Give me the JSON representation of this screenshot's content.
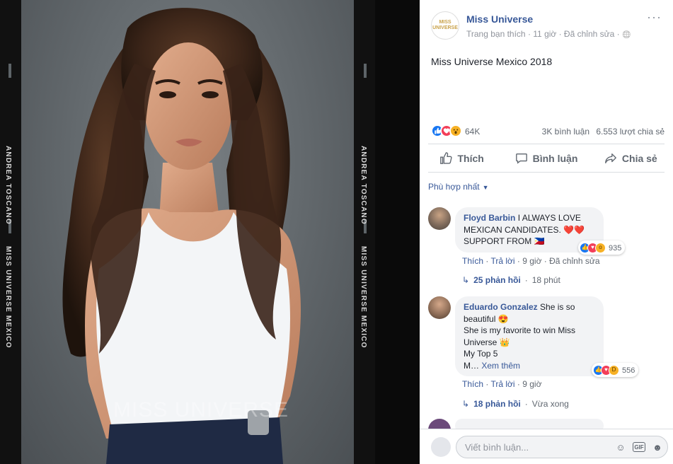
{
  "photo": {
    "side_label_name": "ANDREA TOSCANO",
    "side_label_title": "MISS UNIVERSE MEXICO",
    "watermark": "MISS UNIVERSE"
  },
  "post": {
    "page_avatar_top": "MISS",
    "page_avatar_bottom": "UNIVERSE",
    "page_name": "Miss Universe",
    "meta": "Trang bạn thích · 11 giờ · Đã chỉnh sửa ·",
    "globe_icon": "🌐",
    "more_icon": "···",
    "caption": "Miss Universe Mexico 2018",
    "reaction_count": "64K",
    "comment_count": "3K bình luận",
    "share_count": "6.553 lượt chia sẻ",
    "actions": {
      "like": "Thích",
      "comment": "Bình luận",
      "share": "Chia sẻ"
    },
    "sort_label": "Phù hợp nhất"
  },
  "comments": [
    {
      "author": "Floyd Barbin",
      "text": "I ALWAYS LOVE MEXICAN CANDIDATES. ❤️❤️ SUPPORT FROM 🇵🇭",
      "reaction_count": "935",
      "like_label": "Thích",
      "reply_label": "Trả lời",
      "time": "9 giờ",
      "edited": "Đã chỉnh sửa",
      "replies_label": "25 phản hồi",
      "replies_time": "18 phút"
    },
    {
      "author": "Eduardo Gonzalez",
      "text_line1": "She is so beautiful 😍",
      "text_line2": "She is my favorite to win Miss Universe 👑",
      "text_line3": "My Top 5",
      "text_line4": "M…",
      "see_more": "Xem thêm",
      "reaction_count": "556",
      "like_label": "Thích",
      "reply_label": "Trả lời",
      "time": "9 giờ",
      "replies_label": "18 phản hồi",
      "replies_time": "Vừa xong"
    }
  ],
  "input": {
    "placeholder": "Viết bình luận...",
    "emoji_icon": "☺",
    "gif_icon": "GIF",
    "sticker_icon": "☻"
  },
  "colors": {
    "link": "#385898",
    "like_blue": "#1877f2",
    "love_red": "#f33e58",
    "wow_yellow": "#f7b125"
  }
}
